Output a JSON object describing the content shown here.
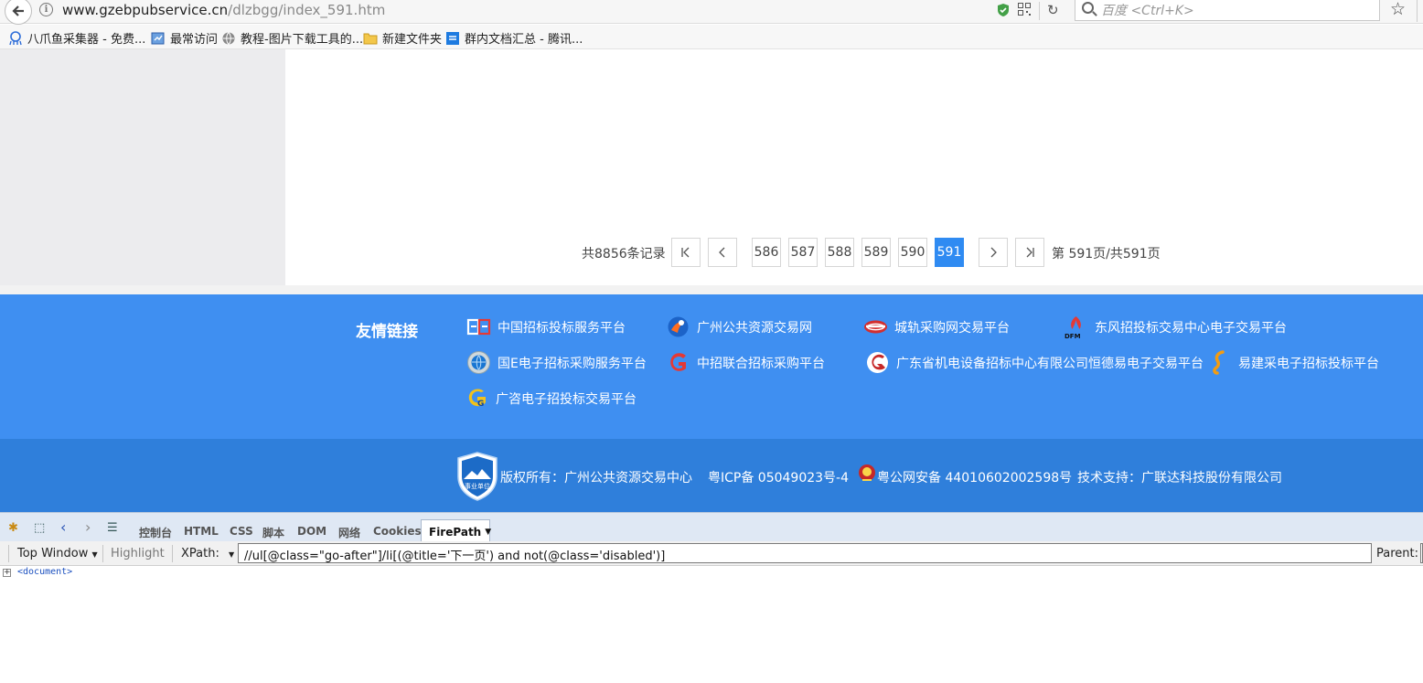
{
  "browser": {
    "url_host": "www.gzebpubservice.cn",
    "url_path": "/dlzbgg/index_591.htm",
    "search_placeholder": "百度 <Ctrl+K>",
    "bookmarks": [
      "八爪鱼采集器 - 免费...",
      "最常访问",
      "教程-图片下载工具的...",
      "新建文件夹",
      "群内文档汇总 - 腾讯..."
    ]
  },
  "pagination": {
    "total": "共8856条记录",
    "first_icon": "first-page-icon",
    "prev_icon": "prev-page-icon",
    "pages": [
      "586",
      "587",
      "588",
      "589",
      "590",
      "591"
    ],
    "active_page": "591",
    "next_icon": "next-page-icon",
    "last_icon": "last-page-icon",
    "info": "第 591页/共591页"
  },
  "links": {
    "title": "友情链接",
    "items": [
      "中国招标投标服务平台",
      "广州公共资源交易网",
      "城轨采购网交易平台",
      "东风招投标交易中心电子交易平台",
      "国E电子招标采购服务平台",
      "中招联合招标采购平台",
      "广东省机电设备招标中心有限公司恒德易电子交易平台",
      "易建采电子招标投标平台",
      "广咨电子招投标交易平台"
    ]
  },
  "footer": {
    "badge_text": "事业单位",
    "copyright": "版权所有：广州公共资源交易中心",
    "icp": "粤ICP备 05049023号-4",
    "police": "粤公网安备 44010602002598号",
    "support": "技术支持：广联达科技股份有限公司"
  },
  "firebug": {
    "tabs": [
      "控制台",
      "HTML",
      "CSS",
      "脚本",
      "DOM",
      "网络",
      "Cookies"
    ],
    "active_tab": "FirePath",
    "top_window": "Top Window",
    "highlight": "Highlight",
    "xpath_label": "XPath:",
    "xpath_value": "//ul[@class=\"go-after\"]/li[(@title='下一页') and not(@class='disabled')]",
    "parent_label": "Parent:",
    "tree_node": "<document>"
  },
  "colors": {
    "links_band": "#3f8ff1",
    "footer_band": "#2f7fdb",
    "active_page": "#2f8bf2"
  }
}
